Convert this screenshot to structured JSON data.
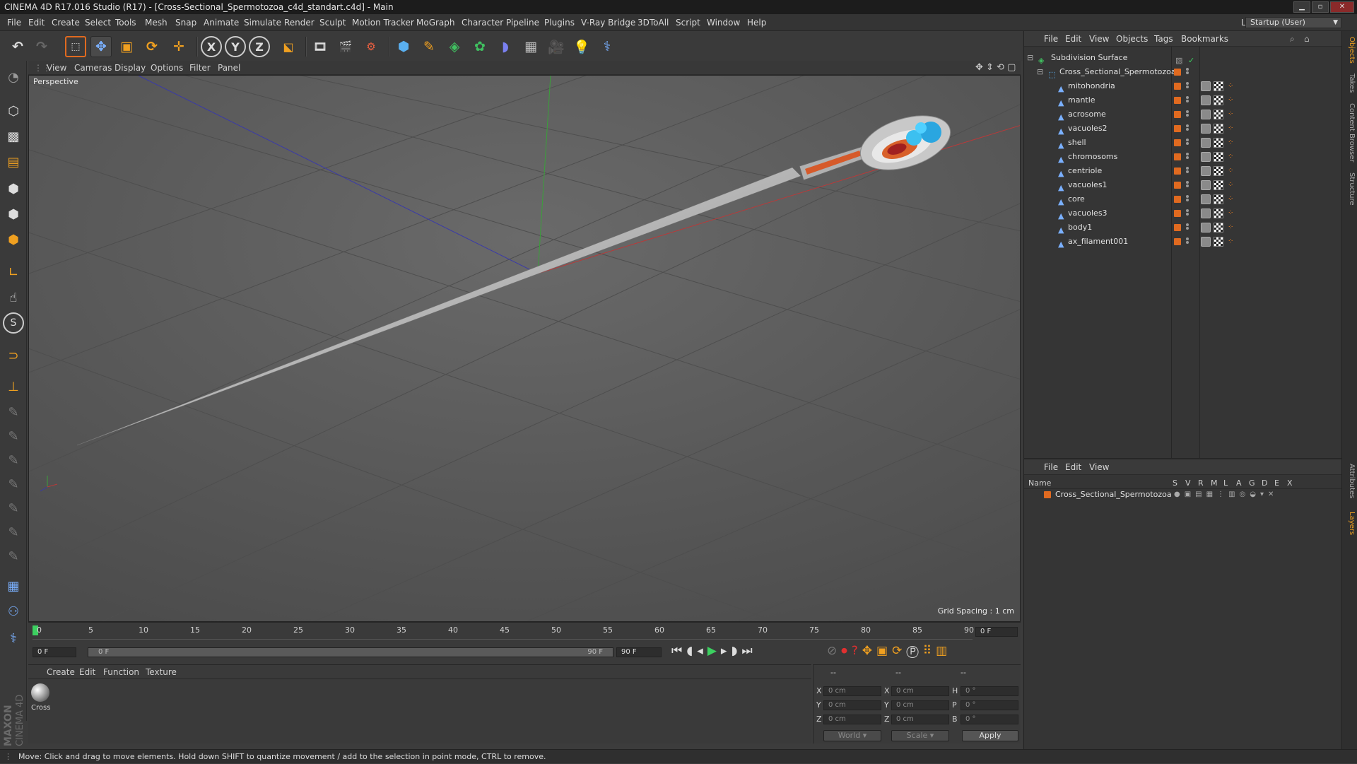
{
  "window": {
    "title": "CINEMA 4D R17.016 Studio (R17) - [Cross-Sectional_Spermotozoa_c4d_standart.c4d] - Main"
  },
  "menubar": {
    "items": [
      "File",
      "Edit",
      "Create",
      "Select",
      "Tools",
      "Mesh",
      "Snap",
      "Animate",
      "Simulate",
      "Render",
      "Sculpt",
      "Motion Tracker",
      "MoGraph",
      "Character",
      "Pipeline",
      "Plugins",
      "V-Ray Bridge",
      "3DToAll",
      "Script",
      "Window",
      "Help"
    ],
    "layout_label": "Layout:",
    "layout_value": "Startup (User)"
  },
  "toolbar": {
    "icons": [
      "undo-icon",
      "redo-icon",
      "live-selection-icon",
      "move-icon",
      "scale-icon",
      "rotate-icon",
      "select-recent-icon",
      "x-axis-icon",
      "y-axis-icon",
      "z-axis-icon",
      "coordinate-system-icon",
      "render-view-icon",
      "render-picture-viewer-icon",
      "edit-render-settings-icon",
      "cube-icon",
      "pen-spline-icon",
      "subdivision-icon",
      "array-icon",
      "deformer-icon",
      "floor-icon",
      "camera-icon",
      "light-icon",
      "python-icon"
    ],
    "axis_labels": [
      "X",
      "Y",
      "Z"
    ]
  },
  "viewport": {
    "menu": [
      "View",
      "Cameras",
      "Display",
      "Options",
      "Filter",
      "Panel"
    ],
    "label": "Perspective",
    "grid_spacing": "Grid Spacing : 1 cm"
  },
  "timeline": {
    "ticks": [
      "0",
      "5",
      "10",
      "15",
      "20",
      "25",
      "30",
      "35",
      "40",
      "45",
      "50",
      "55",
      "60",
      "65",
      "70",
      "75",
      "80",
      "85",
      "90"
    ],
    "current_frame": "0 F",
    "start_field": "0 F",
    "range_start": "0 F",
    "range_end": "90 F",
    "end_field": "90 F"
  },
  "materials": {
    "menu": [
      "Create",
      "Edit",
      "Function",
      "Texture"
    ],
    "items": [
      {
        "name": "Cross"
      }
    ]
  },
  "coords": {
    "header": [
      "--",
      "--",
      "--"
    ],
    "rows": [
      {
        "axis": "X",
        "pos": "0 cm",
        "size_axis": "X",
        "size": "0 cm",
        "rot_axis": "H",
        "rot": "0 °"
      },
      {
        "axis": "Y",
        "pos": "0 cm",
        "size_axis": "Y",
        "size": "0 cm",
        "rot_axis": "P",
        "rot": "0 °"
      },
      {
        "axis": "Z",
        "pos": "0 cm",
        "size_axis": "Z",
        "size": "0 cm",
        "rot_axis": "B",
        "rot": "0 °"
      }
    ],
    "mode": "World",
    "size_mode": "Scale",
    "apply": "Apply"
  },
  "object_manager": {
    "menu": [
      "File",
      "Edit",
      "View",
      "Objects",
      "Tags",
      "Bookmarks"
    ],
    "root": "Subdivision Surface",
    "group": "Cross_Sectional_Spermotozoa",
    "children": [
      "mitohondria",
      "mantle",
      "acrosome",
      "vacuoles2",
      "shell",
      "chromosoms",
      "centriole",
      "vacuoles1",
      "core",
      "vacuoles3",
      "body1",
      "ax_filament001"
    ]
  },
  "layer_manager": {
    "menu": [
      "File",
      "Edit",
      "View"
    ],
    "columns": [
      "Name",
      "S",
      "V",
      "R",
      "M",
      "L",
      "A",
      "G",
      "D",
      "E",
      "X"
    ],
    "layers": [
      "Cross_Sectional_Spermotozoa"
    ]
  },
  "right_tabs": [
    "Objects",
    "Takes",
    "Content Browser",
    "Structure",
    "Attributes",
    "Layers"
  ],
  "status": "Move: Click and drag to move elements. Hold down SHIFT to quantize movement / add to the selection in point mode, CTRL to remove.",
  "brand": "MAXON CINEMA 4D",
  "colors": {
    "accent": "#e06a20",
    "active_frame": "#3cd060",
    "axis_x": "#c03030",
    "axis_y": "#30a030",
    "axis_z": "#3030b0"
  }
}
